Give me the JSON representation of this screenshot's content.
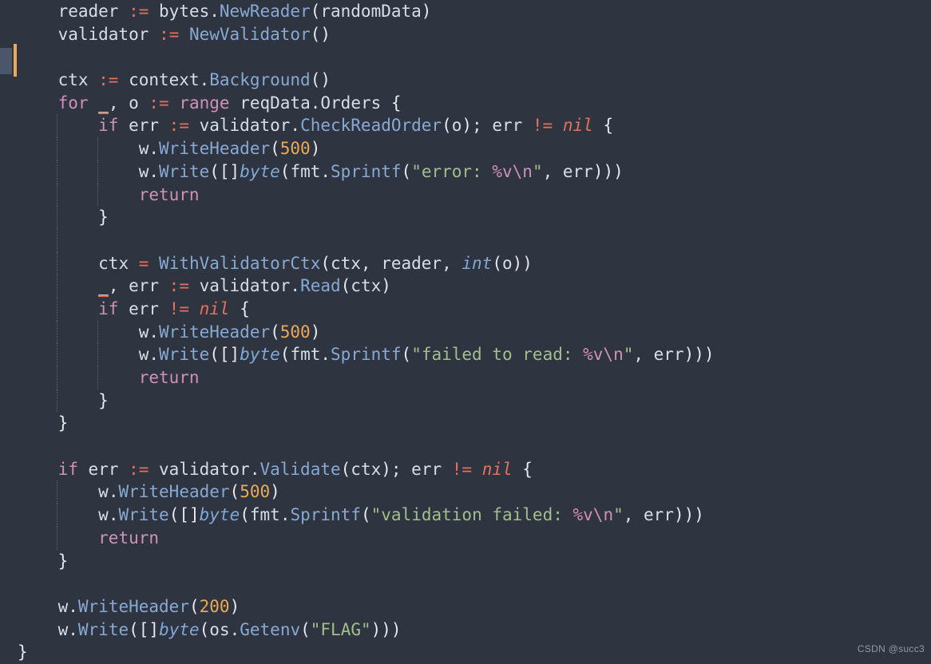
{
  "editor": {
    "language": "Go",
    "background_color": "#2e3440",
    "default_text_color": "#d8dee9",
    "font_size_px": 21,
    "line_height_px": 28.7,
    "gutter": {
      "selection_block_color": "#4c566a",
      "cursor_bar_color": "#ebab56"
    },
    "indent_guide_color": "#5c6676",
    "theme_colors": {
      "keyword": "#cf91b8",
      "function": "#88a9d3",
      "operator": "#e8705a",
      "number": "#ebab56",
      "string": "#a3be8c",
      "escape": "#cf91b8",
      "type": "#7fa8d8",
      "nil": "#e8705a",
      "error_underline": "#e8705a"
    }
  },
  "watermark": {
    "text": "CSDN @succ3"
  },
  "code": {
    "lines": [
      {
        "n": 1,
        "indent": 1,
        "guides": [],
        "text": "reader := bytes.NewReader(randomData)",
        "tokens": [
          {
            "v": "reader ",
            "c": "t-plain"
          },
          {
            "v": ":=",
            "c": "t-op"
          },
          {
            "v": " bytes",
            "c": "t-plain"
          },
          {
            "v": ".",
            "c": "t-plain"
          },
          {
            "v": "NewReader",
            "c": "t-fn"
          },
          {
            "v": "(",
            "c": "t-paren"
          },
          {
            "v": "randomData",
            "c": "t-plain"
          },
          {
            "v": ")",
            "c": "t-paren"
          }
        ]
      },
      {
        "n": 2,
        "indent": 1,
        "guides": [],
        "text": "validator := NewValidator()",
        "tokens": [
          {
            "v": "validator ",
            "c": "t-plain"
          },
          {
            "v": ":=",
            "c": "t-op"
          },
          {
            "v": " ",
            "c": "t-plain"
          },
          {
            "v": "NewValidator",
            "c": "t-fn"
          },
          {
            "v": "(",
            "c": "t-paren"
          },
          {
            "v": ")",
            "c": "t-paren"
          }
        ]
      },
      {
        "n": 3,
        "indent": 1,
        "guides": [],
        "text": "",
        "tokens": []
      },
      {
        "n": 4,
        "indent": 1,
        "guides": [],
        "text": "ctx := context.Background()",
        "tokens": [
          {
            "v": "ctx ",
            "c": "t-plain"
          },
          {
            "v": ":=",
            "c": "t-op"
          },
          {
            "v": " context",
            "c": "t-plain"
          },
          {
            "v": ".",
            "c": "t-plain"
          },
          {
            "v": "Background",
            "c": "t-fn"
          },
          {
            "v": "(",
            "c": "t-paren"
          },
          {
            "v": ")",
            "c": "t-paren"
          }
        ]
      },
      {
        "n": 5,
        "indent": 1,
        "guides": [],
        "text": "for _, o := range reqData.Orders {",
        "tokens": [
          {
            "v": "for",
            "c": "t-kw"
          },
          {
            "v": " ",
            "c": "t-plain"
          },
          {
            "v": "_",
            "c": "t-err"
          },
          {
            "v": ", o ",
            "c": "t-plain"
          },
          {
            "v": ":=",
            "c": "t-op"
          },
          {
            "v": " ",
            "c": "t-plain"
          },
          {
            "v": "range",
            "c": "t-kw"
          },
          {
            "v": " reqData",
            "c": "t-plain"
          },
          {
            "v": ".",
            "c": "t-plain"
          },
          {
            "v": "Orders",
            "c": "t-plain"
          },
          {
            "v": " ",
            "c": "t-plain"
          },
          {
            "v": "{",
            "c": "t-brace"
          }
        ]
      },
      {
        "n": 6,
        "indent": 2,
        "guides": [
          1
        ],
        "text": "if err := validator.CheckReadOrder(o); err != nil {",
        "tokens": [
          {
            "v": "if",
            "c": "t-kw"
          },
          {
            "v": " err ",
            "c": "t-plain"
          },
          {
            "v": ":=",
            "c": "t-op"
          },
          {
            "v": " validator",
            "c": "t-plain"
          },
          {
            "v": ".",
            "c": "t-plain"
          },
          {
            "v": "CheckReadOrder",
            "c": "t-fn"
          },
          {
            "v": "(",
            "c": "t-paren"
          },
          {
            "v": "o",
            "c": "t-plain"
          },
          {
            "v": ")",
            "c": "t-paren"
          },
          {
            "v": "; err ",
            "c": "t-plain"
          },
          {
            "v": "!=",
            "c": "t-op"
          },
          {
            "v": " ",
            "c": "t-plain"
          },
          {
            "v": "nil",
            "c": "t-nil"
          },
          {
            "v": " ",
            "c": "t-plain"
          },
          {
            "v": "{",
            "c": "t-brace"
          }
        ]
      },
      {
        "n": 7,
        "indent": 3,
        "guides": [
          1,
          2
        ],
        "text": "w.WriteHeader(500)",
        "tokens": [
          {
            "v": "w",
            "c": "t-plain"
          },
          {
            "v": ".",
            "c": "t-plain"
          },
          {
            "v": "WriteHeader",
            "c": "t-fn"
          },
          {
            "v": "(",
            "c": "t-paren"
          },
          {
            "v": "500",
            "c": "t-num"
          },
          {
            "v": ")",
            "c": "t-paren"
          }
        ]
      },
      {
        "n": 8,
        "indent": 3,
        "guides": [
          1,
          2
        ],
        "text": "w.Write([]byte(fmt.Sprintf(\"error: %v\\n\", err)))",
        "tokens": [
          {
            "v": "w",
            "c": "t-plain"
          },
          {
            "v": ".",
            "c": "t-plain"
          },
          {
            "v": "Write",
            "c": "t-fn"
          },
          {
            "v": "(",
            "c": "t-paren"
          },
          {
            "v": "[]",
            "c": "t-paren"
          },
          {
            "v": "byte",
            "c": "t-type"
          },
          {
            "v": "(",
            "c": "t-paren"
          },
          {
            "v": "fmt",
            "c": "t-plain"
          },
          {
            "v": ".",
            "c": "t-plain"
          },
          {
            "v": "Sprintf",
            "c": "t-fn"
          },
          {
            "v": "(",
            "c": "t-paren"
          },
          {
            "v": "\"error: ",
            "c": "t-str"
          },
          {
            "v": "%v\\n",
            "c": "t-esc"
          },
          {
            "v": "\"",
            "c": "t-str"
          },
          {
            "v": ", err",
            "c": "t-plain"
          },
          {
            "v": ")))",
            "c": "t-paren"
          }
        ]
      },
      {
        "n": 9,
        "indent": 3,
        "guides": [
          1,
          2
        ],
        "text": "return",
        "tokens": [
          {
            "v": "return",
            "c": "t-kw"
          }
        ]
      },
      {
        "n": 10,
        "indent": 2,
        "guides": [
          1
        ],
        "text": "}",
        "tokens": [
          {
            "v": "}",
            "c": "t-brace"
          }
        ]
      },
      {
        "n": 11,
        "indent": 2,
        "guides": [
          1
        ],
        "text": "",
        "tokens": []
      },
      {
        "n": 12,
        "indent": 2,
        "guides": [
          1
        ],
        "text": "ctx = WithValidatorCtx(ctx, reader, int(o))",
        "tokens": [
          {
            "v": "ctx ",
            "c": "t-plain"
          },
          {
            "v": "=",
            "c": "t-op"
          },
          {
            "v": " ",
            "c": "t-plain"
          },
          {
            "v": "WithValidatorCtx",
            "c": "t-fn"
          },
          {
            "v": "(",
            "c": "t-paren"
          },
          {
            "v": "ctx, reader, ",
            "c": "t-plain"
          },
          {
            "v": "int",
            "c": "t-type"
          },
          {
            "v": "(",
            "c": "t-paren"
          },
          {
            "v": "o",
            "c": "t-plain"
          },
          {
            "v": "))",
            "c": "t-paren"
          }
        ]
      },
      {
        "n": 13,
        "indent": 2,
        "guides": [
          1
        ],
        "text": "_, err := validator.Read(ctx)",
        "tokens": [
          {
            "v": "_",
            "c": "t-err"
          },
          {
            "v": ", err ",
            "c": "t-plain"
          },
          {
            "v": ":=",
            "c": "t-op"
          },
          {
            "v": " validator",
            "c": "t-plain"
          },
          {
            "v": ".",
            "c": "t-plain"
          },
          {
            "v": "Read",
            "c": "t-fn"
          },
          {
            "v": "(",
            "c": "t-paren"
          },
          {
            "v": "ctx",
            "c": "t-plain"
          },
          {
            "v": ")",
            "c": "t-paren"
          }
        ]
      },
      {
        "n": 14,
        "indent": 2,
        "guides": [
          1
        ],
        "text": "if err != nil {",
        "tokens": [
          {
            "v": "if",
            "c": "t-kw"
          },
          {
            "v": " err ",
            "c": "t-plain"
          },
          {
            "v": "!=",
            "c": "t-op"
          },
          {
            "v": " ",
            "c": "t-plain"
          },
          {
            "v": "nil",
            "c": "t-nil"
          },
          {
            "v": " ",
            "c": "t-plain"
          },
          {
            "v": "{",
            "c": "t-brace"
          }
        ]
      },
      {
        "n": 15,
        "indent": 3,
        "guides": [
          1,
          2
        ],
        "text": "w.WriteHeader(500)",
        "tokens": [
          {
            "v": "w",
            "c": "t-plain"
          },
          {
            "v": ".",
            "c": "t-plain"
          },
          {
            "v": "WriteHeader",
            "c": "t-fn"
          },
          {
            "v": "(",
            "c": "t-paren"
          },
          {
            "v": "500",
            "c": "t-num"
          },
          {
            "v": ")",
            "c": "t-paren"
          }
        ]
      },
      {
        "n": 16,
        "indent": 3,
        "guides": [
          1,
          2
        ],
        "text": "w.Write([]byte(fmt.Sprintf(\"failed to read: %v\\n\", err)))",
        "tokens": [
          {
            "v": "w",
            "c": "t-plain"
          },
          {
            "v": ".",
            "c": "t-plain"
          },
          {
            "v": "Write",
            "c": "t-fn"
          },
          {
            "v": "(",
            "c": "t-paren"
          },
          {
            "v": "[]",
            "c": "t-paren"
          },
          {
            "v": "byte",
            "c": "t-type"
          },
          {
            "v": "(",
            "c": "t-paren"
          },
          {
            "v": "fmt",
            "c": "t-plain"
          },
          {
            "v": ".",
            "c": "t-plain"
          },
          {
            "v": "Sprintf",
            "c": "t-fn"
          },
          {
            "v": "(",
            "c": "t-paren"
          },
          {
            "v": "\"failed to read: ",
            "c": "t-str"
          },
          {
            "v": "%v\\n",
            "c": "t-esc"
          },
          {
            "v": "\"",
            "c": "t-str"
          },
          {
            "v": ", err",
            "c": "t-plain"
          },
          {
            "v": ")))",
            "c": "t-paren"
          }
        ]
      },
      {
        "n": 17,
        "indent": 3,
        "guides": [
          1,
          2
        ],
        "text": "return",
        "tokens": [
          {
            "v": "return",
            "c": "t-kw"
          }
        ]
      },
      {
        "n": 18,
        "indent": 2,
        "guides": [
          1
        ],
        "text": "}",
        "tokens": [
          {
            "v": "}",
            "c": "t-brace"
          }
        ]
      },
      {
        "n": 19,
        "indent": 1,
        "guides": [],
        "text": "}",
        "tokens": [
          {
            "v": "}",
            "c": "t-brace"
          }
        ]
      },
      {
        "n": 20,
        "indent": 1,
        "guides": [],
        "text": "",
        "tokens": []
      },
      {
        "n": 21,
        "indent": 1,
        "guides": [],
        "text": "if err := validator.Validate(ctx); err != nil {",
        "tokens": [
          {
            "v": "if",
            "c": "t-kw"
          },
          {
            "v": " err ",
            "c": "t-plain"
          },
          {
            "v": ":=",
            "c": "t-op"
          },
          {
            "v": " validator",
            "c": "t-plain"
          },
          {
            "v": ".",
            "c": "t-plain"
          },
          {
            "v": "Validate",
            "c": "t-fn"
          },
          {
            "v": "(",
            "c": "t-paren"
          },
          {
            "v": "ctx",
            "c": "t-plain"
          },
          {
            "v": ")",
            "c": "t-paren"
          },
          {
            "v": "; err ",
            "c": "t-plain"
          },
          {
            "v": "!=",
            "c": "t-op"
          },
          {
            "v": " ",
            "c": "t-plain"
          },
          {
            "v": "nil",
            "c": "t-nil"
          },
          {
            "v": " ",
            "c": "t-plain"
          },
          {
            "v": "{",
            "c": "t-brace"
          }
        ]
      },
      {
        "n": 22,
        "indent": 2,
        "guides": [
          1
        ],
        "text": "w.WriteHeader(500)",
        "tokens": [
          {
            "v": "w",
            "c": "t-plain"
          },
          {
            "v": ".",
            "c": "t-plain"
          },
          {
            "v": "WriteHeader",
            "c": "t-fn"
          },
          {
            "v": "(",
            "c": "t-paren"
          },
          {
            "v": "500",
            "c": "t-num"
          },
          {
            "v": ")",
            "c": "t-paren"
          }
        ]
      },
      {
        "n": 23,
        "indent": 2,
        "guides": [
          1
        ],
        "text": "w.Write([]byte(fmt.Sprintf(\"validation failed: %v\\n\", err)))",
        "tokens": [
          {
            "v": "w",
            "c": "t-plain"
          },
          {
            "v": ".",
            "c": "t-plain"
          },
          {
            "v": "Write",
            "c": "t-fn"
          },
          {
            "v": "(",
            "c": "t-paren"
          },
          {
            "v": "[]",
            "c": "t-paren"
          },
          {
            "v": "byte",
            "c": "t-type"
          },
          {
            "v": "(",
            "c": "t-paren"
          },
          {
            "v": "fmt",
            "c": "t-plain"
          },
          {
            "v": ".",
            "c": "t-plain"
          },
          {
            "v": "Sprintf",
            "c": "t-fn"
          },
          {
            "v": "(",
            "c": "t-paren"
          },
          {
            "v": "\"validation failed: ",
            "c": "t-str"
          },
          {
            "v": "%v\\n",
            "c": "t-esc"
          },
          {
            "v": "\"",
            "c": "t-str"
          },
          {
            "v": ", err",
            "c": "t-plain"
          },
          {
            "v": ")))",
            "c": "t-paren"
          }
        ]
      },
      {
        "n": 24,
        "indent": 2,
        "guides": [
          1
        ],
        "text": "return",
        "tokens": [
          {
            "v": "return",
            "c": "t-kw"
          }
        ]
      },
      {
        "n": 25,
        "indent": 1,
        "guides": [],
        "text": "}",
        "tokens": [
          {
            "v": "}",
            "c": "t-brace"
          }
        ]
      },
      {
        "n": 26,
        "indent": 1,
        "guides": [],
        "text": "",
        "tokens": []
      },
      {
        "n": 27,
        "indent": 1,
        "guides": [],
        "text": "w.WriteHeader(200)",
        "tokens": [
          {
            "v": "w",
            "c": "t-plain"
          },
          {
            "v": ".",
            "c": "t-plain"
          },
          {
            "v": "WriteHeader",
            "c": "t-fn"
          },
          {
            "v": "(",
            "c": "t-paren"
          },
          {
            "v": "200",
            "c": "t-num"
          },
          {
            "v": ")",
            "c": "t-paren"
          }
        ]
      },
      {
        "n": 28,
        "indent": 1,
        "guides": [],
        "text": "w.Write([]byte(os.Getenv(\"FLAG\")))",
        "tokens": [
          {
            "v": "w",
            "c": "t-plain"
          },
          {
            "v": ".",
            "c": "t-plain"
          },
          {
            "v": "Write",
            "c": "t-fn"
          },
          {
            "v": "(",
            "c": "t-paren"
          },
          {
            "v": "[]",
            "c": "t-paren"
          },
          {
            "v": "byte",
            "c": "t-type"
          },
          {
            "v": "(",
            "c": "t-paren"
          },
          {
            "v": "os",
            "c": "t-plain"
          },
          {
            "v": ".",
            "c": "t-plain"
          },
          {
            "v": "Getenv",
            "c": "t-fn"
          },
          {
            "v": "(",
            "c": "t-paren"
          },
          {
            "v": "\"FLAG\"",
            "c": "t-str"
          },
          {
            "v": ")))",
            "c": "t-paren"
          }
        ]
      },
      {
        "n": 29,
        "indent": 0,
        "guides": [],
        "text": "}",
        "tokens": [
          {
            "v": "}",
            "c": "t-brace"
          }
        ]
      }
    ]
  }
}
